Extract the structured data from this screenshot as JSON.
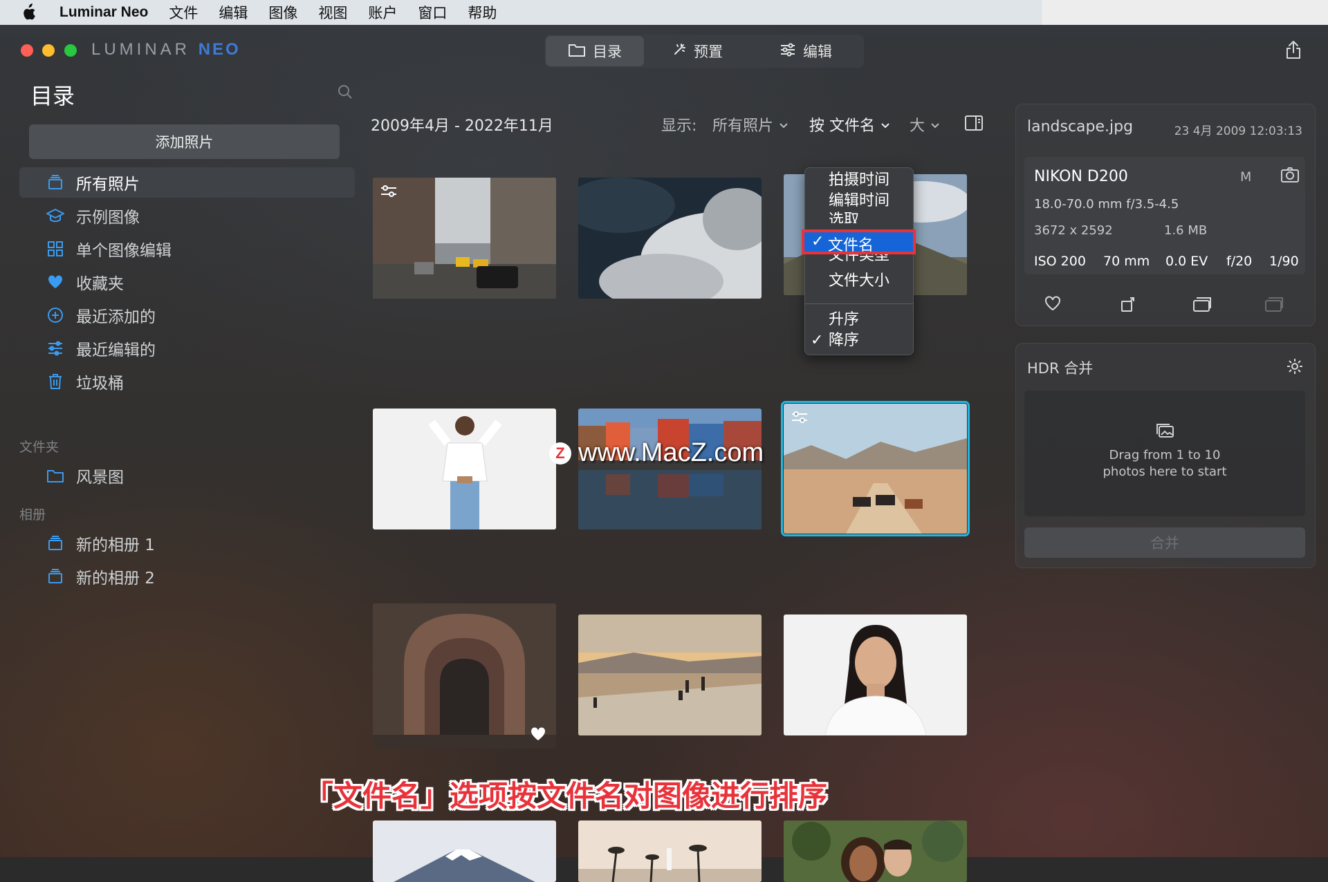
{
  "menubar": {
    "app_name": "Luminar Neo",
    "items": [
      "文件",
      "编辑",
      "图像",
      "视图",
      "账户",
      "窗口",
      "帮助"
    ]
  },
  "brand": {
    "part1": "LUMINAR",
    "part2": "NEO"
  },
  "modes": [
    {
      "label": "目录",
      "icon": "folder-icon",
      "active": true
    },
    {
      "label": "预置",
      "icon": "sparkle-icon",
      "active": false
    },
    {
      "label": "编辑",
      "icon": "sliders-icon",
      "active": false
    }
  ],
  "sidebar": {
    "title": "目录",
    "add_photo": "添加照片",
    "items": [
      {
        "label": "所有照片",
        "icon": "stack-icon",
        "selected": true
      },
      {
        "label": "示例图像",
        "icon": "graduation-cap-icon"
      },
      {
        "label": "单个图像编辑",
        "icon": "grid-icon"
      },
      {
        "label": "收藏夹",
        "icon": "heart-icon"
      },
      {
        "label": "最近添加的",
        "icon": "plus-circle-icon"
      },
      {
        "label": "最近编辑的",
        "icon": "sliders-icon"
      },
      {
        "label": "垃圾桶",
        "icon": "trash-icon"
      }
    ],
    "folders_heading": "文件夹",
    "folders": [
      {
        "label": "风景图",
        "icon": "folder-icon"
      }
    ],
    "albums_heading": "相册",
    "albums": [
      {
        "label": "新的相册 1",
        "icon": "stack-icon"
      },
      {
        "label": "新的相册 2",
        "icon": "stack-icon"
      }
    ]
  },
  "grid_header": {
    "date_range": "2009年4月 - 2022年11月",
    "show_label": "显示:",
    "show_value": "所有照片",
    "sort_value": "按 文件名",
    "size_value": "大"
  },
  "sort_menu": {
    "items": [
      "拍摄时间",
      "编辑时间",
      "选取",
      "文件名",
      "文件类型",
      "文件大小"
    ],
    "selected": "文件名",
    "order_items": [
      "升序",
      "降序"
    ],
    "order_selected": "降序",
    "check": "✓"
  },
  "photos": [
    {
      "name": "city-street",
      "edited": true
    },
    {
      "name": "smoke-clouds"
    },
    {
      "name": "landscape-mountain"
    },
    {
      "name": "woman-white-top"
    },
    {
      "name": "harbor-houses"
    },
    {
      "name": "landscape-cows",
      "edited": true,
      "selected": true
    },
    {
      "name": "church-door",
      "favorite": true
    },
    {
      "name": "beach-sunset"
    },
    {
      "name": "portrait-woman"
    },
    {
      "name": "mount-fuji"
    },
    {
      "name": "palm-beach"
    },
    {
      "name": "couple-portrait"
    }
  ],
  "info_panel": {
    "filename": "landscape.jpg",
    "date": "23 4月 2009 12:03:13",
    "camera": "NIKON D200",
    "mode": "M",
    "lens": "18.0-70.0 mm f/3.5-4.5",
    "dimensions": "3672 x 2592",
    "filesize": "1.6 MB",
    "iso": "ISO 200",
    "focal": "70 mm",
    "ev": "0.0 EV",
    "aperture": "f/20",
    "shutter": "1/90"
  },
  "hdr_panel": {
    "title": "HDR 合并",
    "drop_line1": "Drag from 1 to 10",
    "drop_line2": "photos here to start",
    "merge_button": "合并"
  },
  "watermark": {
    "z": "Z",
    "text": "www.MacZ.com"
  },
  "caption": "「文件名」选项按文件名对图像进行排序",
  "colors": {
    "accent": "#20b8e3",
    "highlight_border": "#e8333b",
    "menu_selected": "#1565d8",
    "sidebar_icon": "#3a9bf0"
  }
}
